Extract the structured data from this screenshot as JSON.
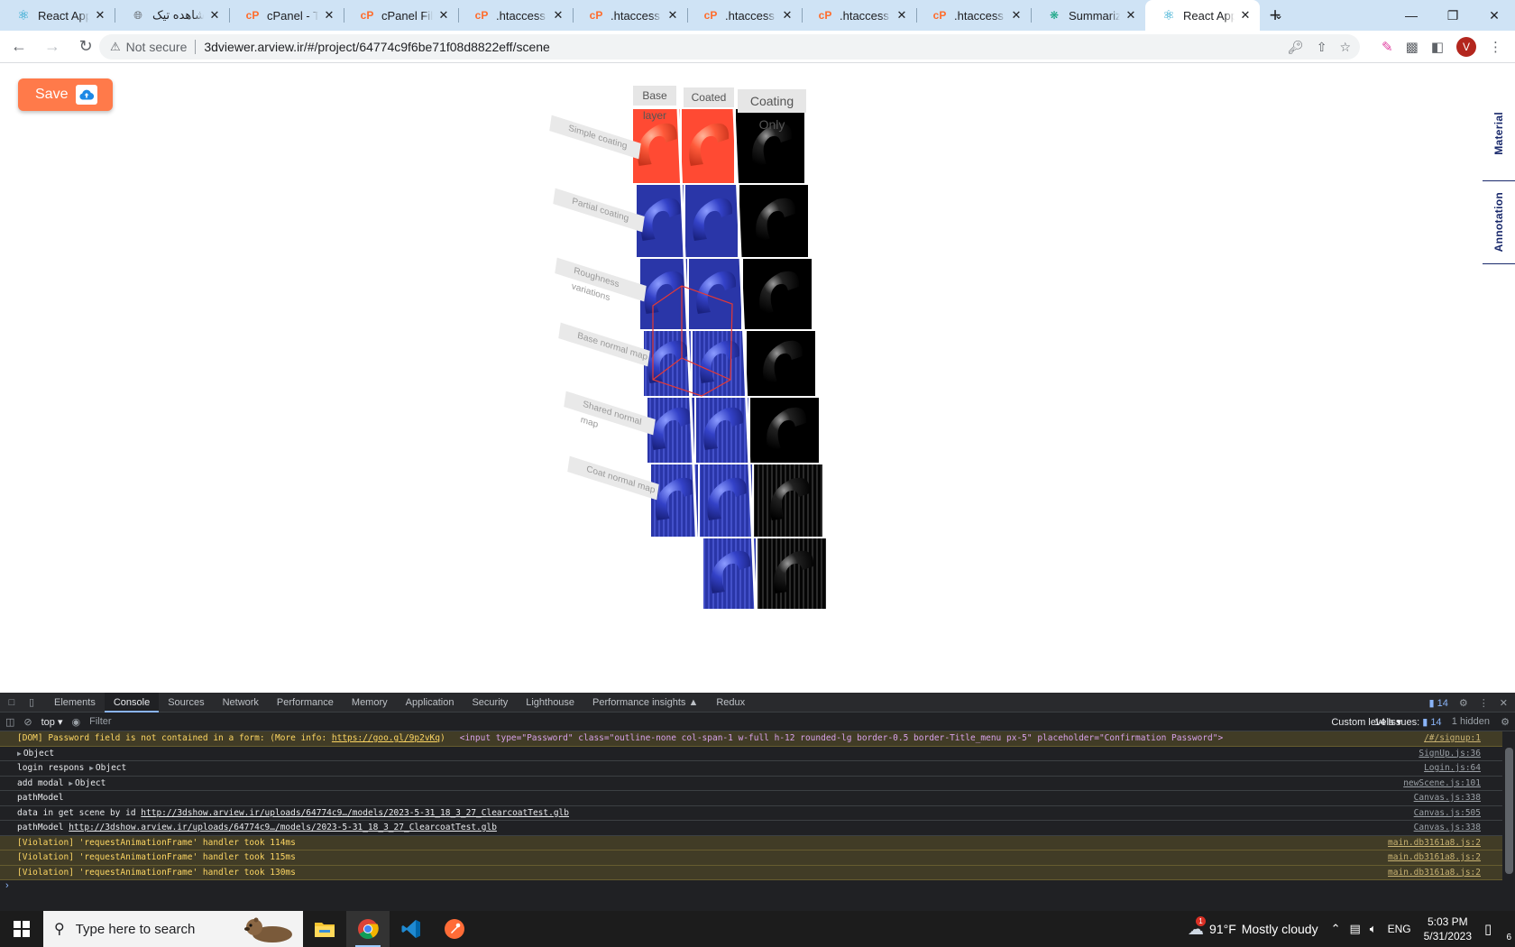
{
  "browser": {
    "tabs": [
      {
        "title": "React App",
        "icon": "react-icon",
        "active": false
      },
      {
        "title": "مشاهده تیک",
        "icon": "globe-icon",
        "active": false
      },
      {
        "title": "cPanel - Too",
        "icon": "cpanel-icon",
        "active": false
      },
      {
        "title": "cPanel File M",
        "icon": "cpanel-icon",
        "active": false
      },
      {
        "title": ".htaccess - c",
        "icon": "cpanel-icon",
        "active": false
      },
      {
        "title": ".htaccess - c",
        "icon": "cpanel-icon",
        "active": false
      },
      {
        "title": ".htaccess - c",
        "icon": "cpanel-icon",
        "active": false
      },
      {
        "title": ".htaccess - c",
        "icon": "cpanel-icon",
        "active": false
      },
      {
        "title": ".htaccess - c",
        "icon": "cpanel-icon",
        "active": false
      },
      {
        "title": "Summarize",
        "icon": "chatgpt-icon",
        "active": false
      },
      {
        "title": "React App",
        "icon": "react-icon",
        "active": true
      }
    ],
    "security_label": "Not secure",
    "url": "3dviewer.arview.ir/#/project/64774c9f6be71f08d8822eff/scene",
    "profile_initial": "V"
  },
  "page": {
    "save_label": "Save",
    "side_tabs": [
      "Material",
      "Annotation"
    ],
    "scene": {
      "column_labels": [
        "Base layer",
        "Coated",
        "Coating Only"
      ],
      "row_labels": [
        "Simple coating",
        "Partial coating",
        "Roughness variations",
        "Base normal map",
        "Shared normal map",
        "Coat normal map"
      ]
    }
  },
  "devtools": {
    "tabs": [
      "Elements",
      "Console",
      "Sources",
      "Network",
      "Performance",
      "Memory",
      "Application",
      "Security",
      "Lighthouse",
      "Performance insights",
      "Redux"
    ],
    "active_tab": "Console",
    "message_count": "14",
    "context": "top",
    "filter_placeholder": "Filter",
    "levels": "Custom levels",
    "issues": "14 Issues:",
    "issues_count": "14",
    "hidden": "1 hidden",
    "console_lines": [
      {
        "kind": "warn",
        "text": "[DOM] Password field is not contained in a form: (More info: ",
        "link": "https://goo.gl/9p2vKq",
        "after": ")",
        "html": "<input type=\"Password\" class=\"outline-none col-span-1 w-full h-12 rounded-lg border-0.5 border-Title_menu px-5\" placeholder=\"Confirmation Password\">",
        "source": "/#/signup:1"
      },
      {
        "kind": "log",
        "text": "",
        "obj": "Object",
        "source": "SignUp.js:36"
      },
      {
        "kind": "log",
        "text": "login respons ",
        "obj": "Object",
        "source": "Login.js:64"
      },
      {
        "kind": "log",
        "text": "add modal ",
        "obj": "Object",
        "source": "newScene.js:101"
      },
      {
        "kind": "log",
        "text": "pathModel",
        "source": "Canvas.js:338"
      },
      {
        "kind": "log",
        "text": "data in get scene by id ",
        "link": "http://3dshow.arview.ir/uploads/64774c9…/models/2023-5-31_18_3_27_ClearcoatTest.glb",
        "source": "Canvas.js:505"
      },
      {
        "kind": "log",
        "text": "pathModel ",
        "link": "http://3dshow.arview.ir/uploads/64774c9…/models/2023-5-31_18_3_27_ClearcoatTest.glb",
        "source": "Canvas.js:338"
      },
      {
        "kind": "warn",
        "text": "[Violation] 'requestAnimationFrame' handler took 114ms",
        "source": "main.db3161a8.js:2"
      },
      {
        "kind": "warn",
        "text": "[Violation] 'requestAnimationFrame' handler took 115ms",
        "source": "main.db3161a8.js:2"
      },
      {
        "kind": "warn",
        "text": "[Violation] 'requestAnimationFrame' handler took 130ms",
        "source": "main.db3161a8.js:2"
      }
    ]
  },
  "taskbar": {
    "search_placeholder": "Type here to search",
    "apps": [
      "file-explorer-icon",
      "chrome-icon",
      "vscode-icon",
      "postman-icon"
    ],
    "weather_temp": "91°F",
    "weather_desc": "Mostly cloudy",
    "weather_badge": "1",
    "language": "ENG",
    "time": "5:03 PM",
    "date": "5/31/2023",
    "notification_count": "6"
  },
  "colors": {
    "save_button": "#ff7a4a",
    "side_tab_text": "#1a2a6c",
    "tabstrip": "#cfe3f5",
    "devtools_bg": "#202124",
    "warn_bg": "#413c26"
  }
}
